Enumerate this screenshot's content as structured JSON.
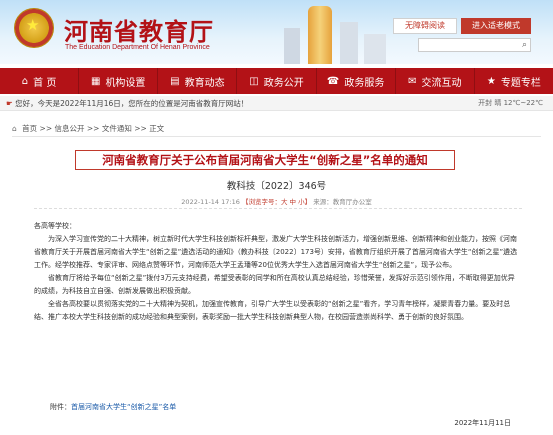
{
  "header": {
    "site_title": "河南省教育厅",
    "site_subtitle": "The Education Department Of Henan Province",
    "accessibility_label": "无障碍阅读",
    "elder_mode_label": "进入适老模式"
  },
  "nav": {
    "items": [
      {
        "icon": "home-icon",
        "glyph": "⌂",
        "label": "首 页"
      },
      {
        "icon": "institution-icon",
        "glyph": "▦",
        "label": "机构设置"
      },
      {
        "icon": "news-icon",
        "glyph": "▤",
        "label": "教育动态"
      },
      {
        "icon": "government-icon",
        "glyph": "◫",
        "label": "政务公开"
      },
      {
        "icon": "service-icon",
        "glyph": "☎",
        "label": "政务服务"
      },
      {
        "icon": "interaction-icon",
        "glyph": "✉",
        "label": "交流互动"
      },
      {
        "icon": "topics-icon",
        "glyph": "★",
        "label": "专题专栏"
      }
    ]
  },
  "welcome": {
    "text": "您好，今天是2022年11月16日，您所在的位置是河南省教育厅网站！",
    "weather": "开封 晴 12℃~22℃"
  },
  "breadcrumb": {
    "items": [
      "首页",
      "信息公开",
      "文件通知",
      "正文"
    ]
  },
  "article": {
    "title": "河南省教育厅关于公布首届河南省大学生“创新之星”名单的通知",
    "doc_number": "教科技〔2022〕346号",
    "date": "2022-11-14 17:16",
    "font_label": "【浏览字号：",
    "font_large": "大",
    "font_medium": "中",
    "font_small": "小",
    "font_end": "】",
    "source": "来源：教育厅办公室",
    "salutation": "各高等学校：",
    "p1": "为深入学习宣传党的二十大精神，树立新时代大学生科技创新标杆典型，激发广大学生科技创新活力，增强创新思维、创新精神和创业能力，按照《河南省教育厅关于开展首届河南省大学生“创新之星”遴选活动的通知》（教办科技〔2022〕173号）安排，省教育厅组织开展了首届河南省大学生“创新之星”遴选工作。经学校推荐、专家评审、网络点赞等环节，河南师范大学王孟璠等20位优秀大学生入选首届河南省大学生“创新之星”，现予公布。",
    "p2": "省教育厅将给予每位“创新之星”拨付3万元支持经费，希望受表彰的同学和所在高校认真总结经验，珍惜荣誉，发挥好示范引领作用，不断取得更加优异的成绩，为科技自立自强、创新发展做出积极贡献。",
    "p3": "全省各高校要以贯彻落实党的二十大精神为契机，加强宣传教育，引导广大学生以受表彰的“创新之星”看齐，学习青年榜样，凝聚青春力量。要及时总结、推广本校大学生科技创新的成功经验和典型案例，表彰奖励一批大学生科技创新典型人物，在校园营造崇尚科学、勇于创新的良好氛围。",
    "attachment_label": "附件：",
    "attachment_link": "首届河南省大学生“创新之星”名单",
    "signature_date": "2022年11月11日"
  }
}
